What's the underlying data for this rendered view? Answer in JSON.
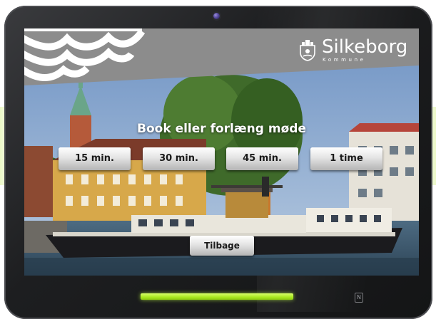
{
  "brand": {
    "name": "Silkeborg",
    "subtitle": "Kommune"
  },
  "booking": {
    "headline": "Book eller forlæng møde",
    "durations": [
      {
        "label": "15 min."
      },
      {
        "label": "30 min."
      },
      {
        "label": "45 min."
      },
      {
        "label": "1 time"
      }
    ],
    "back_label": "Tilbage"
  },
  "device": {
    "status_led_color": "#a8e820",
    "nfc_icon_label": "N"
  },
  "colors": {
    "header_gray": "#8a8a8a",
    "button_text": "#1a1a1a",
    "headline_text": "#ffffff"
  }
}
